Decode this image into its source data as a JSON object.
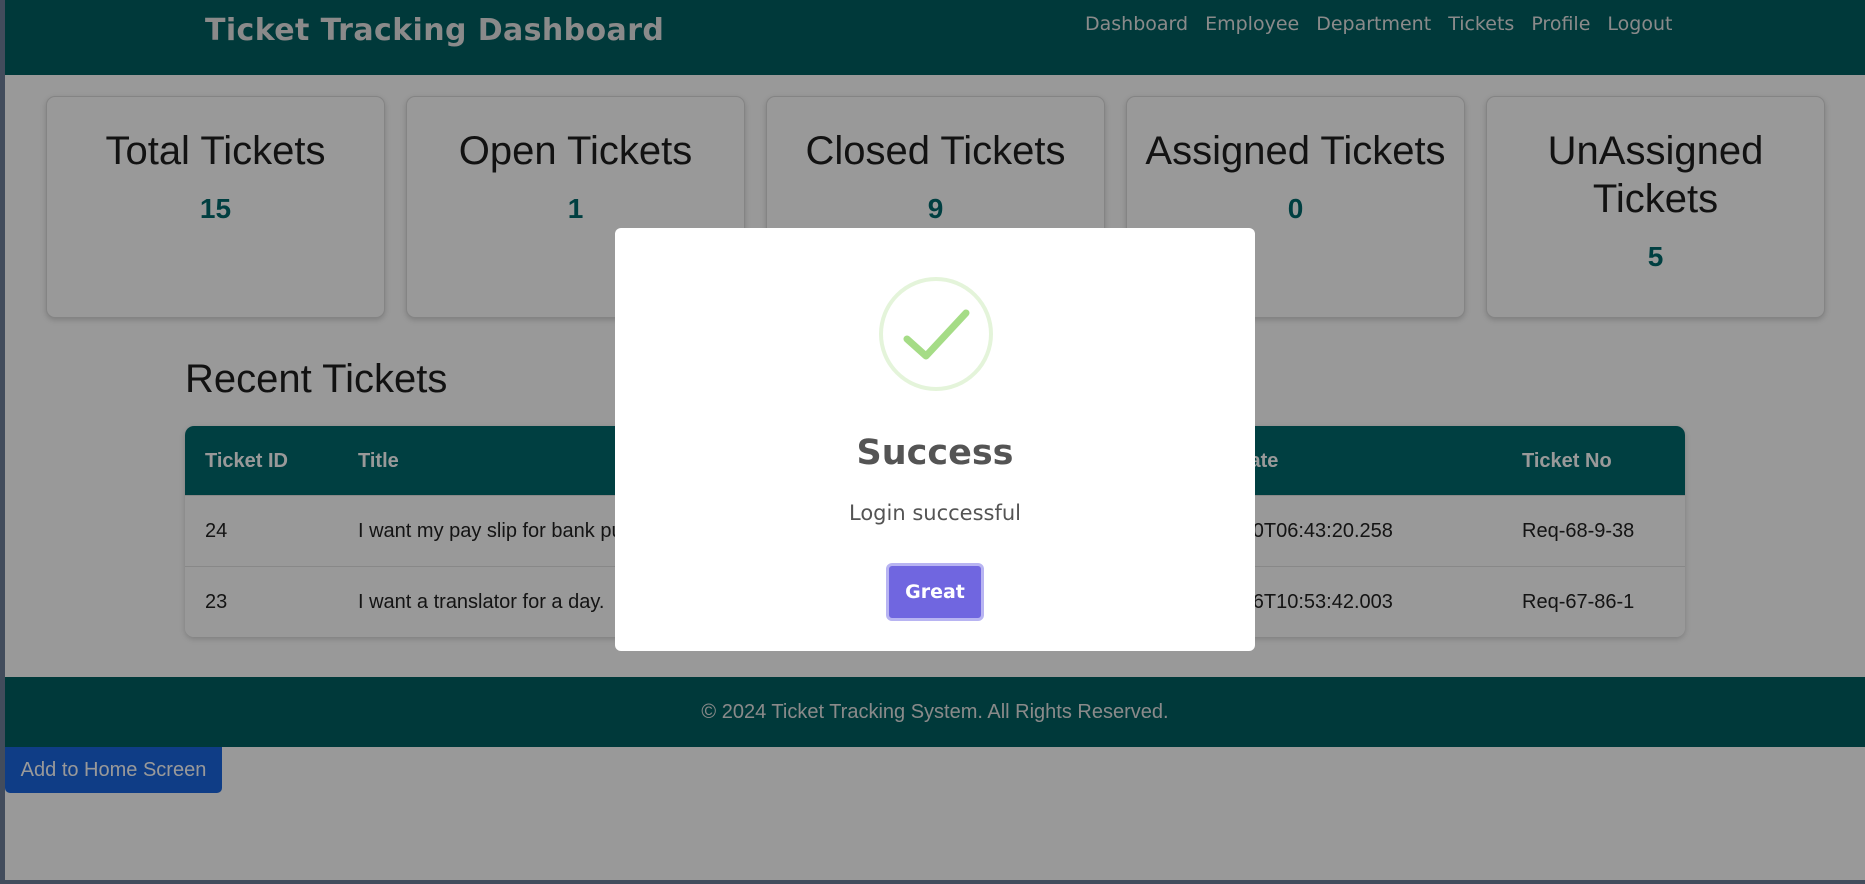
{
  "header": {
    "title": "Ticket Tracking Dashboard",
    "nav": [
      "Dashboard",
      "Employee",
      "Department",
      "Tickets",
      "Profile",
      "Logout"
    ]
  },
  "stats": [
    {
      "label": "Total Tickets",
      "value": "15"
    },
    {
      "label": "Open Tickets",
      "value": "1"
    },
    {
      "label": "Closed Tickets",
      "value": "9"
    },
    {
      "label": "Assigned Tickets",
      "value": "0"
    },
    {
      "label": "UnAssigned Tickets",
      "value": "5"
    }
  ],
  "recent": {
    "title": "Recent Tickets",
    "columns": [
      "Ticket ID",
      "Title",
      "Date",
      "Ticket No"
    ],
    "rows": [
      {
        "id": "24",
        "title": "I want my pay slip for bank pu",
        "date": "-30T06:43:20.258",
        "no": "Req-68-9-38"
      },
      {
        "id": "23",
        "title": "I want a translator for a day.",
        "date": "-16T10:53:42.003",
        "no": "Req-67-86-1"
      }
    ]
  },
  "footer": {
    "text": "© 2024 Ticket Tracking System. All Rights Reserved."
  },
  "add_to_home": {
    "label": "Add to Home Screen"
  },
  "modal": {
    "title": "Success",
    "message": "Login successful",
    "button": "Great",
    "icon": "checkmark-icon"
  },
  "colors": {
    "primary": "#005f61",
    "table_header": "#006a6d",
    "stat_value": "#006a6d",
    "modal_button": "#7066e0",
    "success_green": "#a5dc86",
    "add_to_home": "#1a66e0"
  }
}
